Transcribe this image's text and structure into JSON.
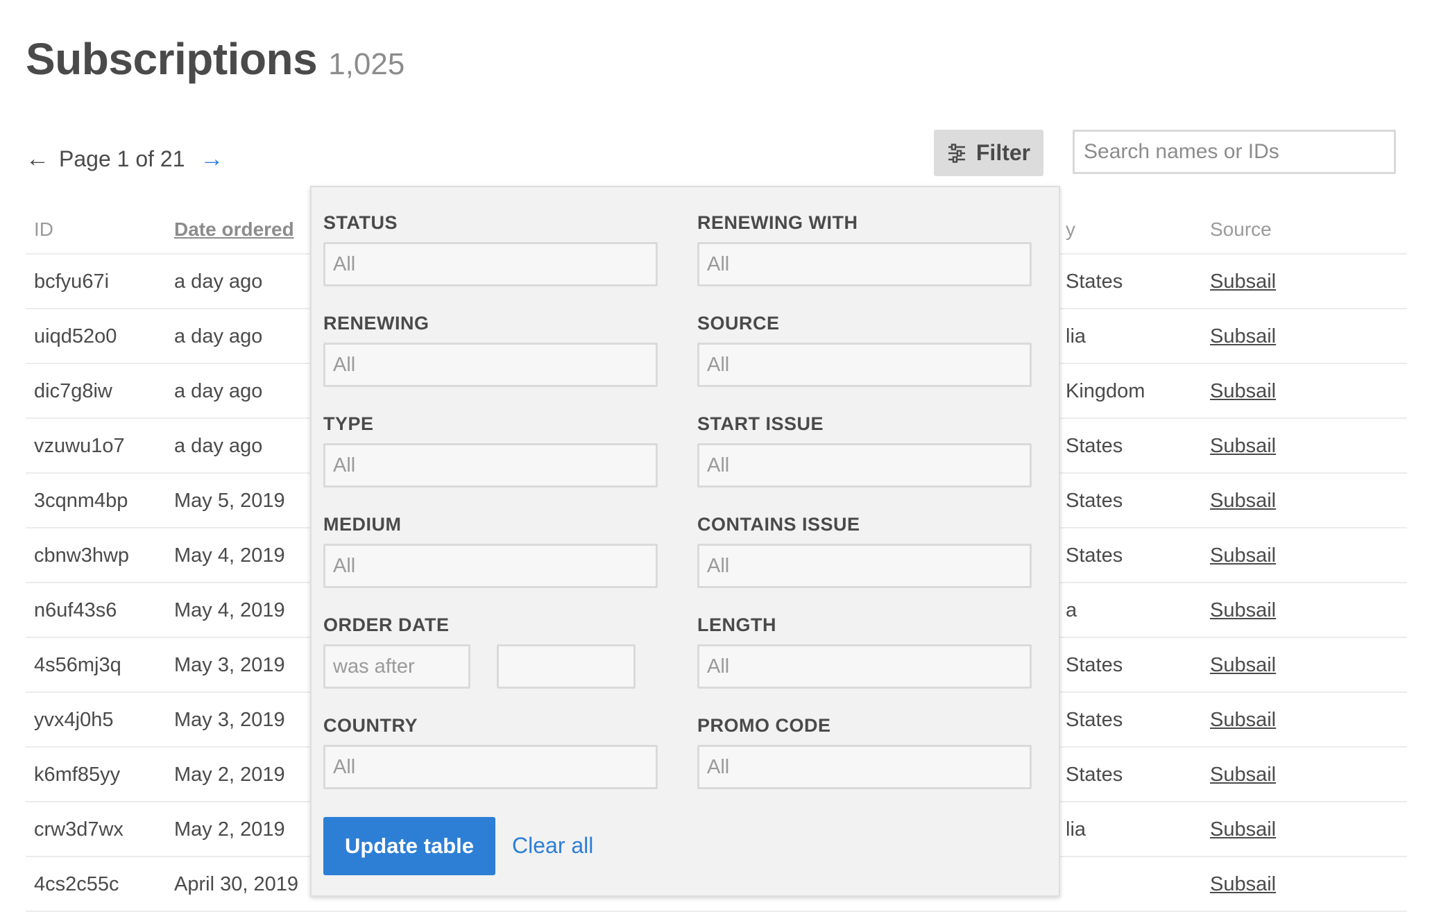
{
  "header": {
    "title": "Subscriptions",
    "count": "1,025"
  },
  "pager": {
    "prev_arrow": "←",
    "text": "Page 1 of 21",
    "next_arrow": "→"
  },
  "toolbar": {
    "filter_label": "Filter",
    "search_placeholder": "Search names or IDs"
  },
  "table": {
    "columns": {
      "id": "ID",
      "date": "Date ordered",
      "country": "y",
      "source": "Source"
    },
    "rows": [
      {
        "id": "bcfyu67i",
        "date": "a day ago",
        "country": "States",
        "source": "Subsail"
      },
      {
        "id": "uiqd52o0",
        "date": "a day ago",
        "country": "lia",
        "source": "Subsail"
      },
      {
        "id": "dic7g8iw",
        "date": "a day ago",
        "country": "Kingdom",
        "source": "Subsail"
      },
      {
        "id": "vzuwu1o7",
        "date": "a day ago",
        "country": "States",
        "source": "Subsail"
      },
      {
        "id": "3cqnm4bp",
        "date": "May 5, 2019",
        "country": "States",
        "source": "Subsail"
      },
      {
        "id": "cbnw3hwp",
        "date": "May 4, 2019",
        "country": "States",
        "source": "Subsail"
      },
      {
        "id": "n6uf43s6",
        "date": "May 4, 2019",
        "country": "a",
        "source": "Subsail"
      },
      {
        "id": "4s56mj3q",
        "date": "May 3, 2019",
        "country": "States",
        "source": "Subsail"
      },
      {
        "id": "yvx4j0h5",
        "date": "May 3, 2019",
        "country": "States",
        "source": "Subsail"
      },
      {
        "id": "k6mf85yy",
        "date": "May 2, 2019",
        "country": "States",
        "source": "Subsail"
      },
      {
        "id": "crw3d7wx",
        "date": "May 2, 2019",
        "country": "lia",
        "source": "Subsail"
      },
      {
        "id": "4cs2c55c",
        "date": "April 30, 2019",
        "country": "",
        "source": "Subsail"
      }
    ]
  },
  "filters": {
    "status": {
      "label": "STATUS",
      "value": "All"
    },
    "renewing_with": {
      "label": "RENEWING WITH",
      "value": "All"
    },
    "renewing": {
      "label": "RENEWING",
      "value": "All"
    },
    "source": {
      "label": "SOURCE",
      "value": "All"
    },
    "type": {
      "label": "TYPE",
      "value": "All"
    },
    "start_issue": {
      "label": "START ISSUE",
      "value": "All"
    },
    "medium": {
      "label": "MEDIUM",
      "value": "All"
    },
    "contains_issue": {
      "label": "CONTAINS ISSUE",
      "value": "All"
    },
    "order_date": {
      "label": "ORDER DATE",
      "operator": "was after",
      "value": ""
    },
    "length": {
      "label": "LENGTH",
      "value": "All"
    },
    "country": {
      "label": "COUNTRY",
      "value": "All"
    },
    "promo_code": {
      "label": "PROMO CODE",
      "value": "All"
    },
    "update_label": "Update table",
    "clear_label": "Clear all"
  },
  "colors": {
    "accent": "#2d7fd6",
    "panel_bg": "#f2f2f2",
    "text": "#4a4a4a"
  },
  "icons": {
    "filter": "sliders-icon"
  }
}
